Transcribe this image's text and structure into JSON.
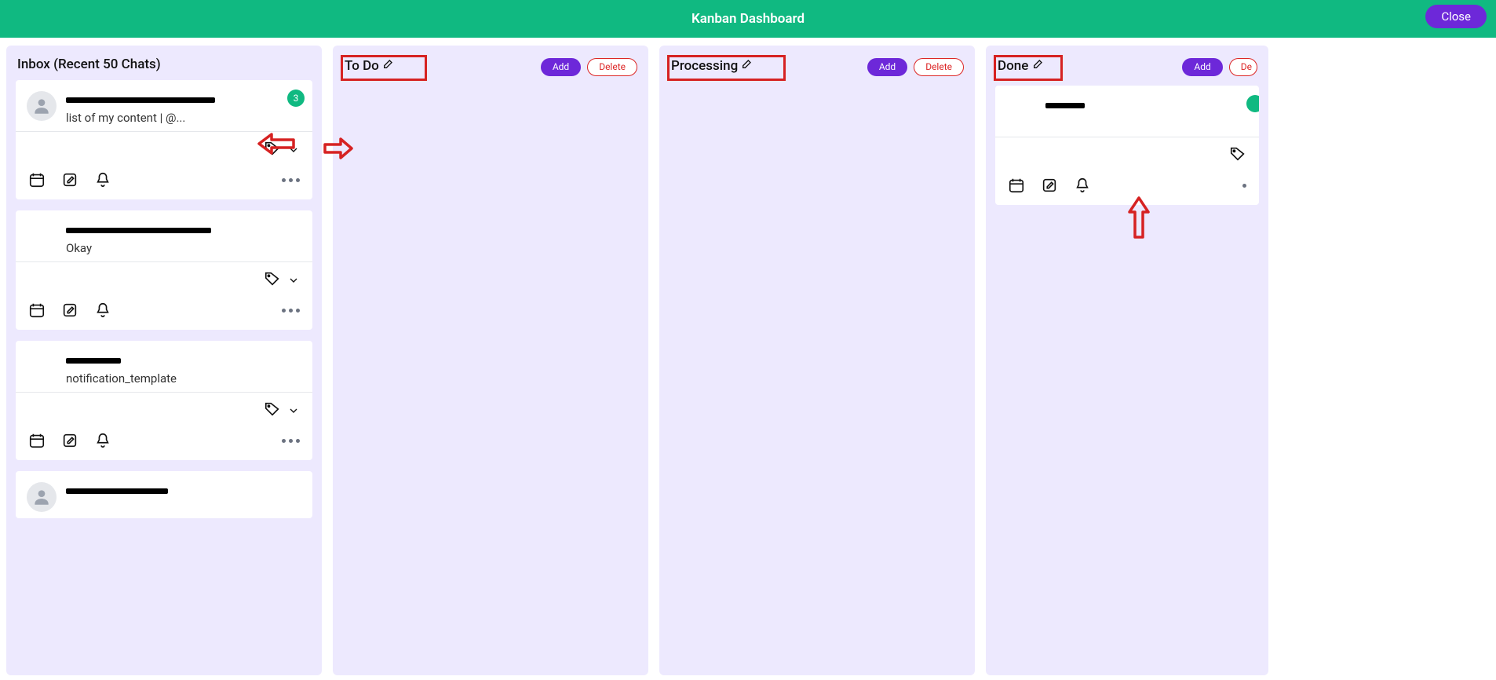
{
  "header": {
    "title": "Kanban Dashboard",
    "close_label": "Close"
  },
  "columns": {
    "inbox": {
      "title": "Inbox (Recent 50 Chats)"
    },
    "todo": {
      "title": "To Do",
      "add_label": "Add",
      "delete_label": "Delete"
    },
    "processing": {
      "title": "Processing",
      "add_label": "Add",
      "delete_label": "Delete"
    },
    "done": {
      "title": "Done",
      "add_label": "Add",
      "delete_label": "De"
    }
  },
  "cards": {
    "inbox": [
      {
        "name": "[redacted-name-1]",
        "message": "list of my content | @...",
        "badge": "3",
        "has_avatar": true
      },
      {
        "name": "[redacted-name-2]",
        "message": "Okay",
        "has_avatar": false
      },
      {
        "name": "[redacted-name-3]",
        "message": "notification_template",
        "has_avatar": false
      },
      {
        "name": "[redacted-name-4]",
        "message": "",
        "has_avatar": true
      }
    ],
    "done": [
      {
        "name": "[redacted-name-5]",
        "message": "",
        "has_avatar": false
      }
    ]
  }
}
